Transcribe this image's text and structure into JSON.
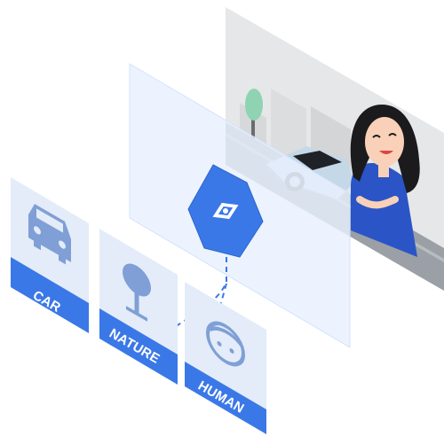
{
  "labels": {
    "car": "CAR",
    "nature": "NATURE",
    "human": "HUMAN"
  },
  "icons": {
    "car": "car-icon",
    "nature": "tree-icon",
    "human": "face-icon",
    "center": "vision-eye-icon"
  },
  "colors": {
    "accent_blue": "#3b78e7",
    "panel_light": "#e8f0fe",
    "card_fill": "#e3ecf8",
    "icon_blue": "#7f9fd6",
    "photo_bg": "#e6e7e8"
  }
}
